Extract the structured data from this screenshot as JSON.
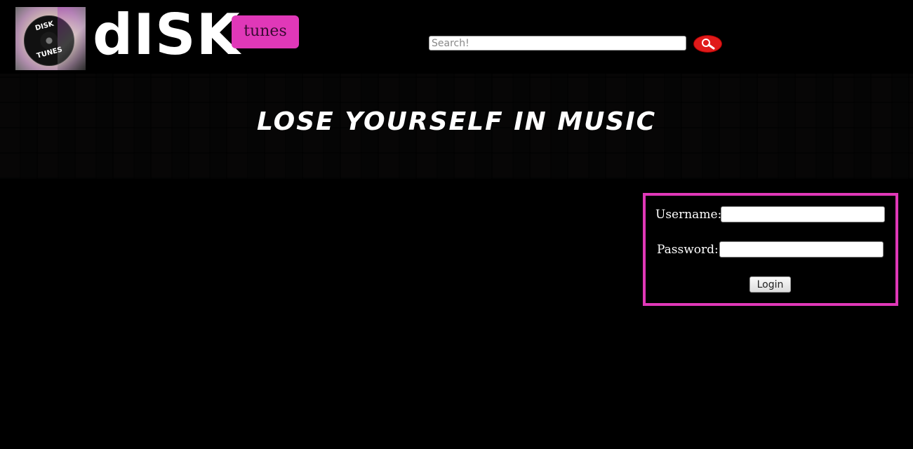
{
  "header": {
    "logo_text_top": "DISK",
    "logo_text_bottom": "TUNES",
    "brand": "dISK",
    "badge": "tunes",
    "search": {
      "placeholder": "Search!",
      "value": ""
    }
  },
  "banner": {
    "title": "LOSE YOURSELF IN MUSIC"
  },
  "login": {
    "username_label": "Username:",
    "password_label": "Password:",
    "username_value": "",
    "password_value": "",
    "button_label": "Login"
  },
  "colors": {
    "accent_pink": "#e038b8",
    "search_button_red": "#e01a1a",
    "background": "#000000"
  }
}
